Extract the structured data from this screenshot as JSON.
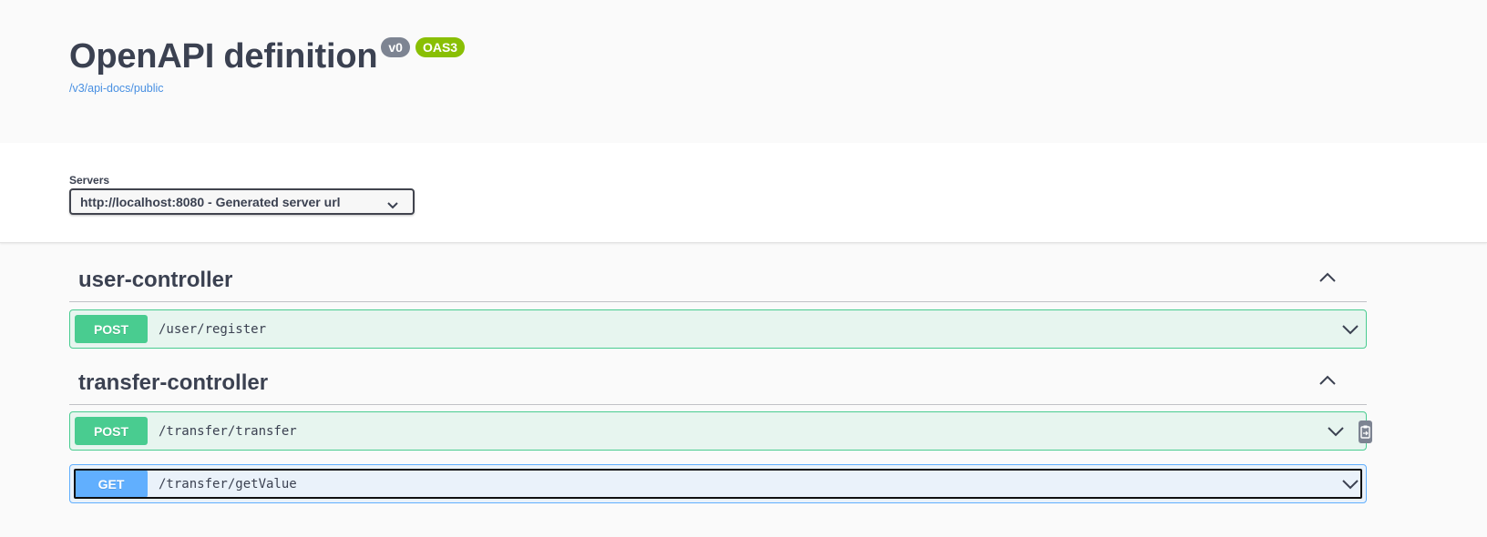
{
  "info": {
    "title": "OpenAPI definition",
    "version_badge": "v0",
    "oas_badge": "OAS3",
    "spec_url": "/v3/api-docs/public"
  },
  "servers": {
    "label": "Servers",
    "selected": "http://localhost:8080 - Generated server url"
  },
  "tags": [
    {
      "name": "user-controller",
      "operations": [
        {
          "method": "POST",
          "path": "/user/register"
        }
      ]
    },
    {
      "name": "transfer-controller",
      "operations": [
        {
          "method": "POST",
          "path": "/transfer/transfer"
        },
        {
          "method": "GET",
          "path": "/transfer/getValue"
        }
      ]
    }
  ],
  "icons": {
    "expanded": "chevron-up-icon",
    "collapsed": "chevron-down-icon",
    "copy": "clipboard-icon"
  },
  "colors": {
    "post": "#49cc90",
    "get": "#61affe",
    "text": "#3b4151",
    "link": "#4990e2",
    "version_badge": "#7d8492",
    "oas_badge": "#89bf04"
  }
}
